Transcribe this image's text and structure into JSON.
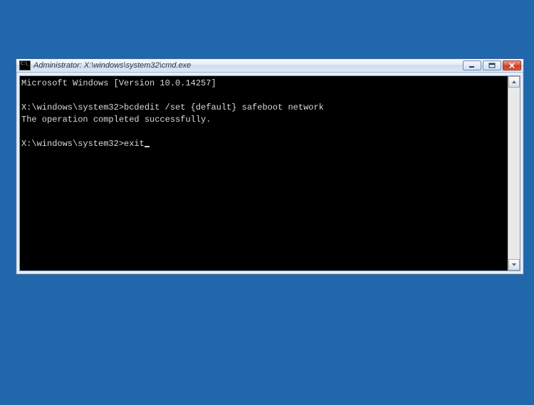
{
  "titlebar": {
    "title": "Administrator: X:\\windows\\system32\\cmd.exe"
  },
  "console": {
    "line_version": "Microsoft Windows [Version 10.0.14257]",
    "line_blank1": "",
    "line_prompt1": "X:\\windows\\system32>bcdedit /set {default} safeboot network",
    "line_result": "The operation completed successfully.",
    "line_blank2": "",
    "line_prompt2_prefix": "X:\\windows\\system32>exit"
  }
}
